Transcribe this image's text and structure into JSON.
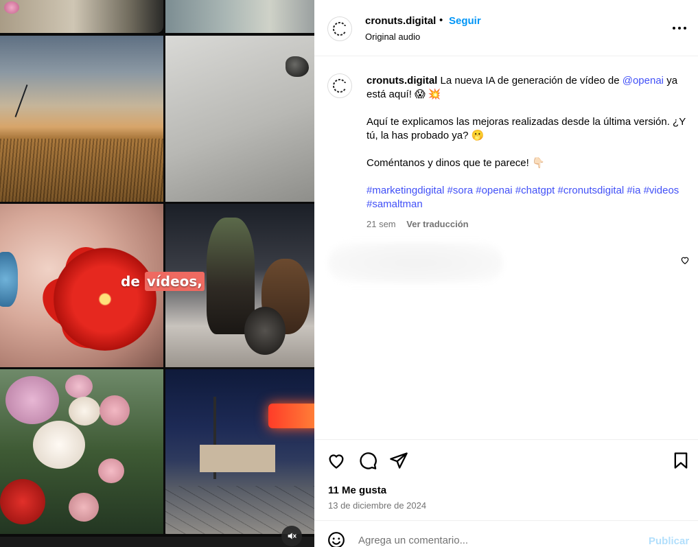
{
  "media": {
    "caption_word1": "de",
    "caption_word2": "vídeos,",
    "mute_icon": "speaker-muted-icon"
  },
  "header": {
    "username": "cronuts.digital",
    "separator": "•",
    "follow_label": "Seguir",
    "audio_label": "Original audio",
    "more_icon": "more-horizontal-icon"
  },
  "post": {
    "username": "cronuts.digital",
    "line1_text": "La nueva IA de generación de vídeo de",
    "mention": "@openai",
    "line1_tail": "ya está aquí! 😱 💥",
    "para2": "Aquí te explicamos las mejoras realizadas desde la última versión. ¿Y tú, la has probado ya? 🫢",
    "para3": "Coméntanos y dinos que te parece! 👇🏻",
    "hashtags": "#marketingdigital #sora #openai #chatgpt #cronutsdigital #ia #videos #samaltman",
    "age": "21 sem",
    "translate_label": "Ver traducción"
  },
  "actions": {
    "likes": "11 Me gusta",
    "date": "13 de diciembre de 2024"
  },
  "comment": {
    "placeholder": "Agrega un comentario...",
    "publish_label": "Publicar"
  },
  "colors": {
    "link": "#4150f7",
    "follow": "#0095f6",
    "muted_text": "#737373",
    "caption_highlight": "#ef6a61"
  }
}
